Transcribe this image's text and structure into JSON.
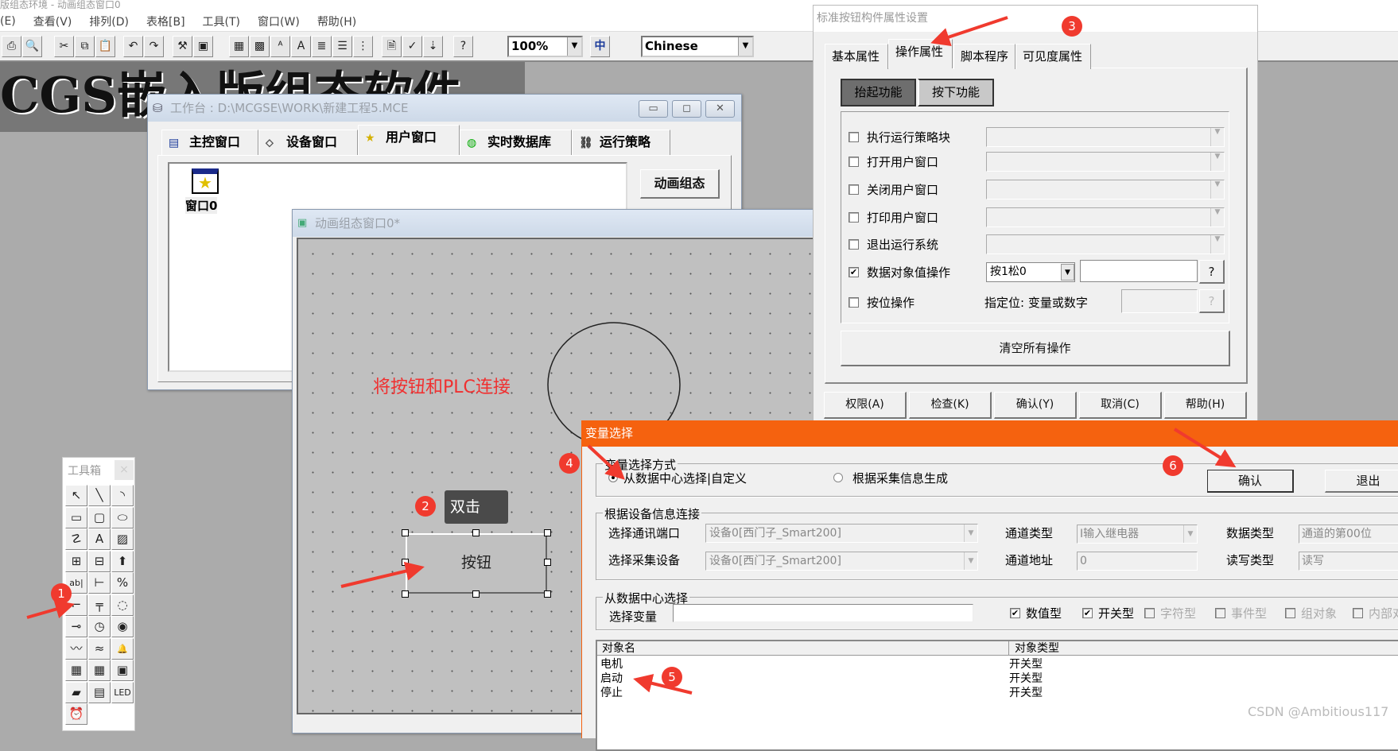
{
  "app": {
    "title": "版组态环境 - 动画组态窗口0"
  },
  "menu": [
    "(E)",
    "查看(V)",
    "排列(D)",
    "表格[B]",
    "工具(T)",
    "窗口(W)",
    "帮助(H)"
  ],
  "toolbar": {
    "icons": [
      "print-icon",
      "print-preview-icon",
      "cut-icon",
      "copy-icon",
      "paste-icon",
      "undo-icon",
      "redo-icon",
      "tools-icon",
      "frame-icon",
      "palette-icon",
      "palette2-icon",
      "font-color-icon",
      "font-icon",
      "align-icon",
      "list-icon",
      "grid-icon",
      "properties-icon",
      "check-icon",
      "order-icon",
      "help-cursor-icon"
    ],
    "glyphs": [
      "⎙",
      "🔍",
      "✂",
      "⧉",
      "📋",
      "↶",
      "↷",
      "⚒",
      "▣",
      "▦",
      "▩",
      "ᴬ",
      "A",
      "≣",
      "☰",
      "⋮",
      "🗎",
      "✓",
      "⇣",
      "?"
    ],
    "zoom": "100%",
    "language_icon": "中",
    "language": "Chinese"
  },
  "banner": "CGS嵌入版组态软件",
  "workbench": {
    "title": "工作台 : D:\\MCGSE\\WORK\\新建工程5.MCE",
    "tabs": [
      {
        "label": "主控窗口",
        "icon": "▤"
      },
      {
        "label": "设备窗口",
        "icon": "⬦"
      },
      {
        "label": "用户窗口",
        "icon": "★"
      },
      {
        "label": "实时数据库",
        "icon": "◍"
      },
      {
        "label": "运行策略",
        "icon": "⛓"
      }
    ],
    "window_item": "窗口0",
    "animate_button": "动画组态"
  },
  "animation_window": {
    "title": "动画组态窗口0*",
    "annotation": "将按钮和PLC连接",
    "button_label": "按钮",
    "tooltip": "双击"
  },
  "toolbox": {
    "title": "工具箱",
    "close": "×",
    "tools": [
      "↖",
      "╲",
      "◝",
      "▭",
      "▢",
      "⬭",
      "☡",
      "A",
      "▨",
      "⊞",
      "⊟",
      "⬆",
      "ab|",
      "⊢",
      "%",
      "⌐",
      "╤",
      "◌",
      "⊸",
      "◷",
      "◉",
      "〰",
      "≈",
      "🔔",
      "▦",
      "▦",
      "▣",
      "▰",
      "▤",
      "LED",
      "⏰"
    ]
  },
  "props_dialog": {
    "title": "标准按钮构件属性设置",
    "tabs": [
      "基本属性",
      "操作属性",
      "脚本程序",
      "可见度属性"
    ],
    "subtabs": [
      "抬起功能",
      "按下功能"
    ],
    "rows": [
      {
        "label": "执行运行策略块",
        "checked": false
      },
      {
        "label": "打开用户窗口",
        "checked": false
      },
      {
        "label": "关闭用户窗口",
        "checked": false
      },
      {
        "label": "打印用户窗口",
        "checked": false
      },
      {
        "label": "退出运行系统",
        "checked": false
      },
      {
        "label": "数据对象值操作",
        "checked": true
      },
      {
        "label": "按位操作",
        "checked": false
      }
    ],
    "data_op_value": "按1松0",
    "data_op_object": "",
    "help": "?",
    "bit_label": "指定位: 变量或数字",
    "clear_button": "清空所有操作",
    "buttons": [
      "权限(A)",
      "检查(K)",
      "确认(Y)",
      "取消(C)",
      "帮助(H)"
    ]
  },
  "var_dialog": {
    "title": "变量选择",
    "mode_group": "变量选择方式",
    "mode_options": [
      "从数据中心选择|自定义",
      "根据采集信息生成"
    ],
    "mode_selected": 0,
    "ok": "确认",
    "exit": "退出",
    "device_group": "根据设备信息连接",
    "port_label": "选择通讯端口",
    "port_value": "设备0[西门子_Smart200]",
    "device_label": "选择采集设备",
    "device_value": "设备0[西门子_Smart200]",
    "channel_type_label": "通道类型",
    "channel_type_value": "I输入继电器",
    "channel_addr_label": "通道地址",
    "channel_addr_value": "0",
    "data_type_label": "数据类型",
    "data_type_value": "通道的第00位",
    "rw_label": "读写类型",
    "rw_value": "读写",
    "center_group": "从数据中心选择",
    "select_var_label": "选择变量",
    "select_var_value": "",
    "filters": [
      {
        "label": "数值型",
        "checked": true,
        "enabled": true
      },
      {
        "label": "开关型",
        "checked": true,
        "enabled": true
      },
      {
        "label": "字符型",
        "checked": false,
        "enabled": false
      },
      {
        "label": "事件型",
        "checked": false,
        "enabled": false
      },
      {
        "label": "组对象",
        "checked": false,
        "enabled": false
      },
      {
        "label": "内部对象",
        "checked": false,
        "enabled": false
      }
    ],
    "columns": [
      "对象名",
      "对象类型"
    ],
    "rows": [
      {
        "name": "电机",
        "type": "开关型"
      },
      {
        "name": "启动",
        "type": "开关型"
      },
      {
        "name": "停止",
        "type": "开关型"
      }
    ]
  },
  "badges": [
    "1",
    "2",
    "3",
    "4",
    "5",
    "6"
  ],
  "accent": "#f5620f",
  "watermark": "CSDN @Ambitious117"
}
